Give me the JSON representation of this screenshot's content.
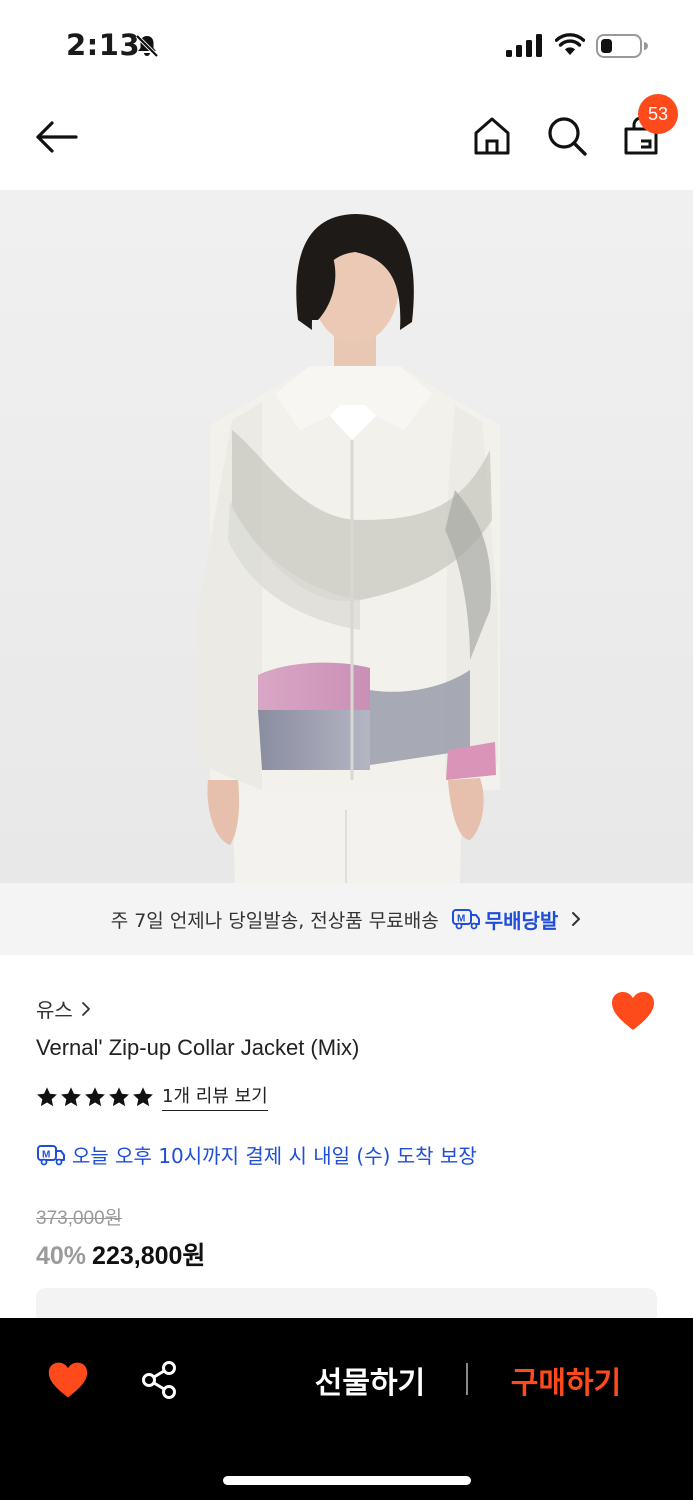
{
  "status_bar": {
    "time": "2:13",
    "icons": [
      "bell-slash-icon",
      "cellular-signal-icon",
      "wifi-icon",
      "battery-icon"
    ]
  },
  "nav": {
    "icons": [
      "back-arrow-icon",
      "home-icon",
      "search-icon",
      "shopping-bag-icon"
    ],
    "cart_count": "53"
  },
  "product_image": {
    "icon": "product-photo"
  },
  "delivery_banner": {
    "text": "주 7일 언제나 당일발송, 전상품 무료배송",
    "brand_label": "무배당발"
  },
  "product": {
    "brand": "유스",
    "name": "Vernal' Zip-up Collar Jacket (Mix)",
    "rating_stars": 5,
    "review_link": "1개 리뷰 보기",
    "arrival_text": "오늘 오후 10시까지 결제 시 내일 (수) 도착 보장",
    "original_price": "373,000원",
    "discount": "40%",
    "sale_price": "223,800원"
  },
  "bottom_bar": {
    "gift_label": "선물하기",
    "buy_label": "구매하기"
  },
  "colors": {
    "accent": "#ff4a1c",
    "link_blue": "#1f4ed8",
    "bottom_bar_bg": "#000000"
  }
}
